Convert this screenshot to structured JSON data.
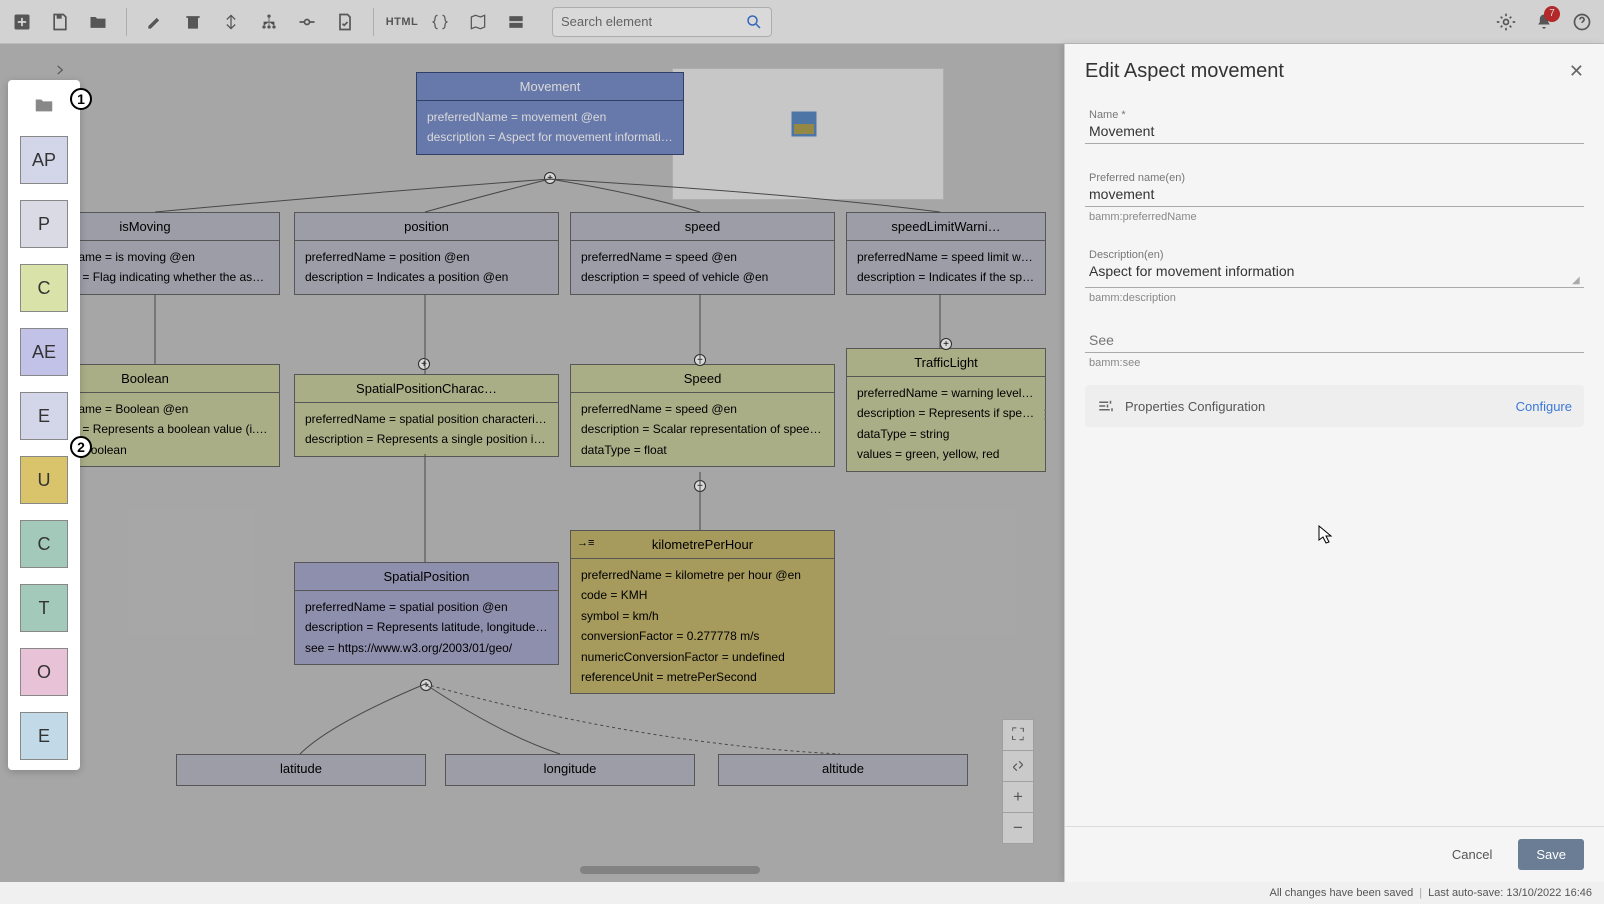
{
  "toolbar": {
    "html_btn": "HTML",
    "search_placeholder": "Search element",
    "notif_count": "7"
  },
  "palette": {
    "items": [
      "AP",
      "P",
      "C",
      "AE",
      "E",
      "U",
      "C",
      "T",
      "O",
      "E"
    ]
  },
  "badges": {
    "b1": "1",
    "b2": "2"
  },
  "nodes": {
    "movement": {
      "title": "Movement",
      "l1": "preferredName = movement @en",
      "l2": "description = Aspect for movement information @en"
    },
    "isMoving": {
      "title": "isMoving",
      "l1": "preferredName = is moving @en",
      "l2": "description = Flag indicating whether the asset is …"
    },
    "position": {
      "title": "position",
      "l1": "preferredName = position @en",
      "l2": "description = Indicates a position @en"
    },
    "speed": {
      "title": "speed",
      "l1": "preferredName = speed @en",
      "l2": "description = speed of vehicle @en"
    },
    "speedLimit": {
      "title": "speedLimitWarni…",
      "l1": "preferredName = speed limit warnin…",
      "l2": "description = Indicates if the speed …"
    },
    "boolean": {
      "title": "Boolean",
      "l1": "preferredName = Boolean @en",
      "l2": "description = Represents a boolean value (i.e. a \"fl…",
      "l3": "dataType = boolean"
    },
    "spatialChar": {
      "title": "SpatialPositionCharac…",
      "l1": "preferredName = spatial position characteristic @en",
      "l2": "description = Represents a single position in spac…"
    },
    "speedChar": {
      "title": "Speed",
      "l1": "preferredName = speed @en",
      "l2": "description = Scalar representation of speed of an…",
      "l3": "dataType = float"
    },
    "traffic": {
      "title": "TrafficLight",
      "l1": "preferredName = warning level @en…",
      "l2": "description = Represents if speed of…",
      "l3": "dataType = string",
      "l4": "values = green, yellow, red"
    },
    "spatialPos": {
      "title": "SpatialPosition",
      "l1": "preferredName = spatial position @en",
      "l2": "description = Represents latitude, longitude and al…",
      "l3": "see = https://www.w3.org/2003/01/geo/"
    },
    "kmh": {
      "title": "kilometrePerHour",
      "l1": "preferredName = kilometre per hour @en",
      "l2": "code = KMH",
      "l3": "symbol = km/h",
      "l4": "conversionFactor = 0.277778 m/s",
      "l5": "numericConversionFactor = undefined",
      "l6": "referenceUnit = metrePerSecond"
    },
    "latitude": {
      "title": "latitude"
    },
    "longitude": {
      "title": "longitude"
    },
    "altitude": {
      "title": "altitude"
    }
  },
  "panel": {
    "title": "Edit Aspect movement",
    "name_label": "Name *",
    "name_value": "Movement",
    "pref_label": "Preferred name(en)",
    "pref_value": "movement",
    "pref_hint": "bamm:preferredName",
    "desc_label": "Description(en)",
    "desc_value": "Aspect for movement information",
    "desc_hint": "bamm:description",
    "see_placeholder": "See",
    "see_hint": "bamm:see",
    "props_label": "Properties Configuration",
    "configure": "Configure",
    "cancel": "Cancel",
    "save": "Save"
  },
  "status": {
    "saved": "All changes have been saved",
    "auto": "Last auto-save: 13/10/2022 16:46"
  },
  "zoom": {
    "fit": "⛶",
    "collapse": "⤢",
    "plus": "+",
    "minus": "−"
  }
}
